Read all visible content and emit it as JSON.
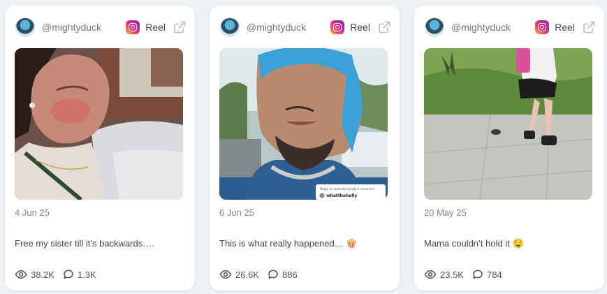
{
  "posts": [
    {
      "handle": "@mightyduck",
      "type_label": "Reel",
      "date": "4 Jun 25",
      "caption": "Free my sister till it’s backwards….",
      "views": "38.2K",
      "comments": "1.3K"
    },
    {
      "handle": "@mightyduck",
      "type_label": "Reel",
      "date": "6 Jun 25",
      "caption": "This is what really happened… 🍿",
      "views": "26.6K",
      "comments": "886",
      "thumb_overlay": {
        "reply_text": "Reply to deshides.beatz's comment",
        "username": "whatthehelly"
      }
    },
    {
      "handle": "@mightyduck",
      "type_label": "Reel",
      "date": "20 May 25",
      "caption": "Mama couldn’t hold it 🤤",
      "views": "23.5K",
      "comments": "784"
    }
  ],
  "icons": {
    "platform": "instagram-icon",
    "external": "external-link-icon",
    "views": "eye-icon",
    "comments": "comment-bubble-icon"
  },
  "colors": {
    "page_background": "#eef1f6",
    "card_background": "#ffffff",
    "muted_text": "#6d7688",
    "body_text": "#3e4555"
  }
}
